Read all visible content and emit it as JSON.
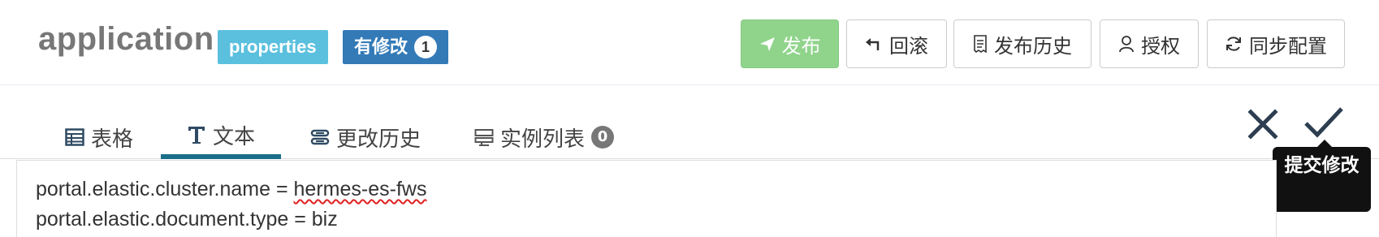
{
  "namespace": {
    "title": "application",
    "format_badge": "properties",
    "modified_badge": "有修改",
    "modified_count": "1"
  },
  "toolbar": {
    "publish_label": "发布",
    "rollback_label": "回滚",
    "publish_history_label": "发布历史",
    "authorize_label": "授权",
    "sync_config_label": "同步配置"
  },
  "tabs": [
    {
      "label": "表格",
      "icon": "table-icon"
    },
    {
      "label": "文本",
      "icon": "text-icon",
      "active": true
    },
    {
      "label": "更改历史",
      "icon": "history-icon"
    },
    {
      "label": "实例列表",
      "icon": "server-icon",
      "count": "0"
    }
  ],
  "editor_actions": {
    "cancel_icon": "close-icon",
    "submit_icon": "check-icon",
    "submit_tooltip": "提交修改"
  },
  "editor": {
    "lines": [
      {
        "key": "portal.elastic.cluster.name",
        "sep": " = ",
        "value": "hermes-es-fws"
      },
      {
        "key": "portal.elastic.document.type",
        "sep": " = ",
        "value": "biz"
      }
    ]
  },
  "colors": {
    "primary_button": "#90d48c",
    "info_badge": "#5bc0de",
    "modified_badge": "#337ab7",
    "active_tab_underline": "#1a6e8a",
    "tooltip_bg": "#111111"
  }
}
